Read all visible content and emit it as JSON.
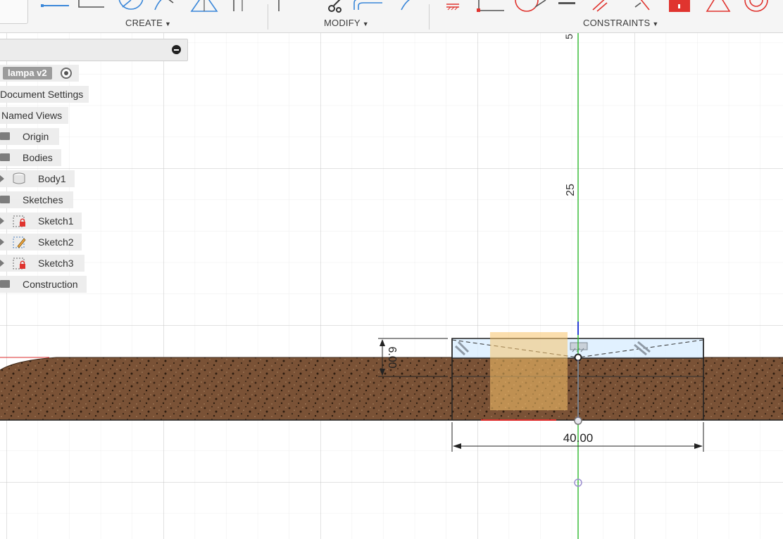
{
  "toolbar": {
    "create_label": "CREATE",
    "modify_label": "MODIFY",
    "constraints_label": "CONSTRAINTS"
  },
  "browser": {
    "root_label": "lampa v2",
    "items": {
      "document_settings": "Document Settings",
      "named_views": "Named Views",
      "origin": "Origin",
      "bodies": "Bodies",
      "body1": "Body1",
      "sketches": "Sketches",
      "sketch1": "Sketch1",
      "sketch2": "Sketch2",
      "sketch3": "Sketch3",
      "construction": "Construction"
    }
  },
  "canvas": {
    "dim_width": "40.00",
    "dim_height": "6.00",
    "axis_tick_25": "25",
    "axis_tick_top": "5"
  },
  "colors": {
    "y_axis": "#2db82d",
    "x_axis": "#e03030",
    "toolbar_icon_blue": "#3a87d9",
    "constraint_red": "#e0342f",
    "wood": "#6e4a33",
    "sketch_fill": "#dcefff",
    "selection": "#f7c26a"
  }
}
